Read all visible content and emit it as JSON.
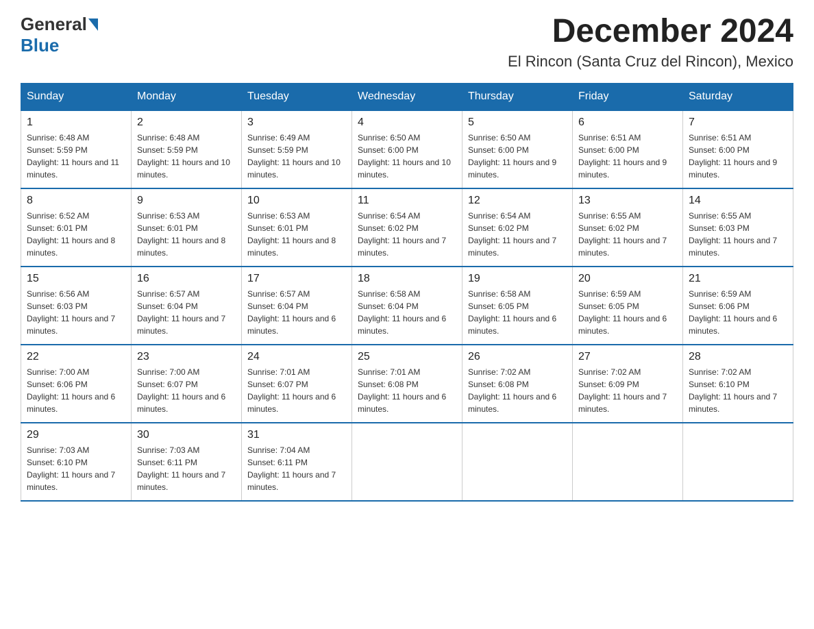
{
  "logo": {
    "general": "General",
    "blue": "Blue"
  },
  "title": {
    "month": "December 2024",
    "location": "El Rincon (Santa Cruz del Rincon), Mexico"
  },
  "headers": [
    "Sunday",
    "Monday",
    "Tuesday",
    "Wednesday",
    "Thursday",
    "Friday",
    "Saturday"
  ],
  "weeks": [
    [
      {
        "day": "1",
        "sunrise": "6:48 AM",
        "sunset": "5:59 PM",
        "daylight": "11 hours and 11 minutes."
      },
      {
        "day": "2",
        "sunrise": "6:48 AM",
        "sunset": "5:59 PM",
        "daylight": "11 hours and 10 minutes."
      },
      {
        "day": "3",
        "sunrise": "6:49 AM",
        "sunset": "5:59 PM",
        "daylight": "11 hours and 10 minutes."
      },
      {
        "day": "4",
        "sunrise": "6:50 AM",
        "sunset": "6:00 PM",
        "daylight": "11 hours and 10 minutes."
      },
      {
        "day": "5",
        "sunrise": "6:50 AM",
        "sunset": "6:00 PM",
        "daylight": "11 hours and 9 minutes."
      },
      {
        "day": "6",
        "sunrise": "6:51 AM",
        "sunset": "6:00 PM",
        "daylight": "11 hours and 9 minutes."
      },
      {
        "day": "7",
        "sunrise": "6:51 AM",
        "sunset": "6:00 PM",
        "daylight": "11 hours and 9 minutes."
      }
    ],
    [
      {
        "day": "8",
        "sunrise": "6:52 AM",
        "sunset": "6:01 PM",
        "daylight": "11 hours and 8 minutes."
      },
      {
        "day": "9",
        "sunrise": "6:53 AM",
        "sunset": "6:01 PM",
        "daylight": "11 hours and 8 minutes."
      },
      {
        "day": "10",
        "sunrise": "6:53 AM",
        "sunset": "6:01 PM",
        "daylight": "11 hours and 8 minutes."
      },
      {
        "day": "11",
        "sunrise": "6:54 AM",
        "sunset": "6:02 PM",
        "daylight": "11 hours and 7 minutes."
      },
      {
        "day": "12",
        "sunrise": "6:54 AM",
        "sunset": "6:02 PM",
        "daylight": "11 hours and 7 minutes."
      },
      {
        "day": "13",
        "sunrise": "6:55 AM",
        "sunset": "6:02 PM",
        "daylight": "11 hours and 7 minutes."
      },
      {
        "day": "14",
        "sunrise": "6:55 AM",
        "sunset": "6:03 PM",
        "daylight": "11 hours and 7 minutes."
      }
    ],
    [
      {
        "day": "15",
        "sunrise": "6:56 AM",
        "sunset": "6:03 PM",
        "daylight": "11 hours and 7 minutes."
      },
      {
        "day": "16",
        "sunrise": "6:57 AM",
        "sunset": "6:04 PM",
        "daylight": "11 hours and 7 minutes."
      },
      {
        "day": "17",
        "sunrise": "6:57 AM",
        "sunset": "6:04 PM",
        "daylight": "11 hours and 6 minutes."
      },
      {
        "day": "18",
        "sunrise": "6:58 AM",
        "sunset": "6:04 PM",
        "daylight": "11 hours and 6 minutes."
      },
      {
        "day": "19",
        "sunrise": "6:58 AM",
        "sunset": "6:05 PM",
        "daylight": "11 hours and 6 minutes."
      },
      {
        "day": "20",
        "sunrise": "6:59 AM",
        "sunset": "6:05 PM",
        "daylight": "11 hours and 6 minutes."
      },
      {
        "day": "21",
        "sunrise": "6:59 AM",
        "sunset": "6:06 PM",
        "daylight": "11 hours and 6 minutes."
      }
    ],
    [
      {
        "day": "22",
        "sunrise": "7:00 AM",
        "sunset": "6:06 PM",
        "daylight": "11 hours and 6 minutes."
      },
      {
        "day": "23",
        "sunrise": "7:00 AM",
        "sunset": "6:07 PM",
        "daylight": "11 hours and 6 minutes."
      },
      {
        "day": "24",
        "sunrise": "7:01 AM",
        "sunset": "6:07 PM",
        "daylight": "11 hours and 6 minutes."
      },
      {
        "day": "25",
        "sunrise": "7:01 AM",
        "sunset": "6:08 PM",
        "daylight": "11 hours and 6 minutes."
      },
      {
        "day": "26",
        "sunrise": "7:02 AM",
        "sunset": "6:08 PM",
        "daylight": "11 hours and 6 minutes."
      },
      {
        "day": "27",
        "sunrise": "7:02 AM",
        "sunset": "6:09 PM",
        "daylight": "11 hours and 7 minutes."
      },
      {
        "day": "28",
        "sunrise": "7:02 AM",
        "sunset": "6:10 PM",
        "daylight": "11 hours and 7 minutes."
      }
    ],
    [
      {
        "day": "29",
        "sunrise": "7:03 AM",
        "sunset": "6:10 PM",
        "daylight": "11 hours and 7 minutes."
      },
      {
        "day": "30",
        "sunrise": "7:03 AM",
        "sunset": "6:11 PM",
        "daylight": "11 hours and 7 minutes."
      },
      {
        "day": "31",
        "sunrise": "7:04 AM",
        "sunset": "6:11 PM",
        "daylight": "11 hours and 7 minutes."
      },
      null,
      null,
      null,
      null
    ]
  ]
}
